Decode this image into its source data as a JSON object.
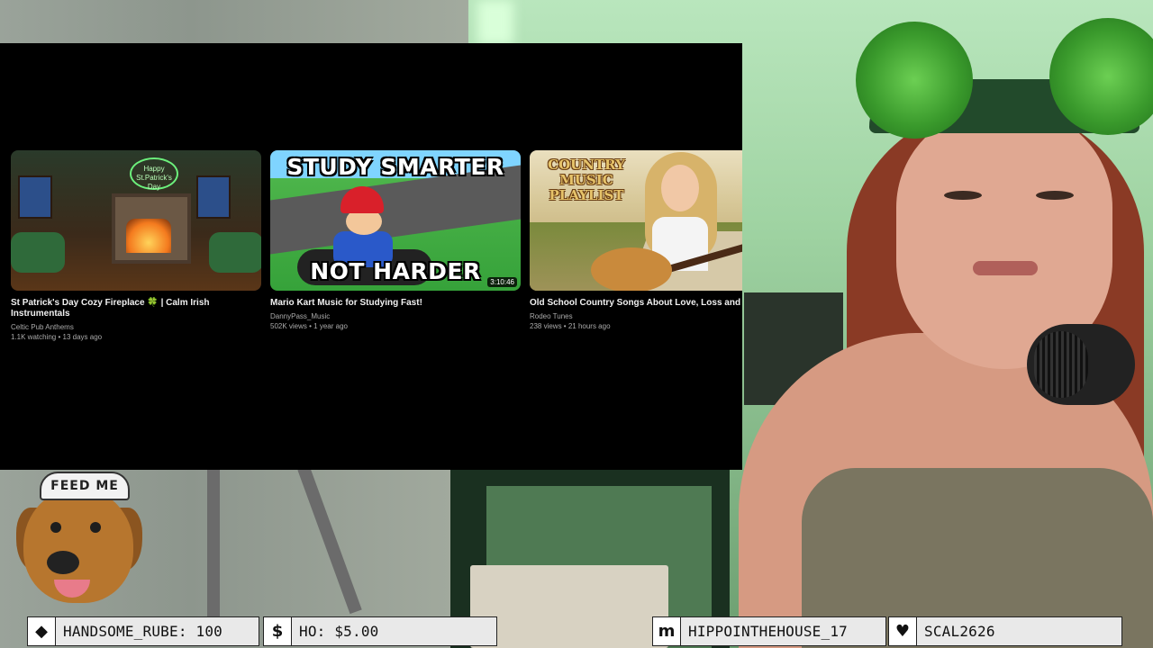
{
  "youtube": {
    "videos": [
      {
        "title": "St Patrick's Day Cozy Fireplace 🍀 | Calm Irish Instrumentals",
        "channel": "Celtic Pub Anthems",
        "meta": "1.1K watching • 13 days ago",
        "thumb_text": "Happy St.Patrick's Day"
      },
      {
        "title": "Mario Kart Music for Studying Fast!",
        "channel": "DannyPass_Music",
        "meta": "502K views • 1 year ago",
        "thumb_top": "STUDY SMARTER",
        "thumb_bottom": "NOT HARDER",
        "duration": "3:10:46"
      },
      {
        "title": "Old School Country Songs About Love, Loss and Re",
        "channel": "Rodeo Tunes",
        "meta": "238 views • 21 hours ago",
        "thumb_logo": "COUNTRY MUSIC PLAYLIST"
      }
    ]
  },
  "overlay": {
    "dog_hat_text": "FEED ME"
  },
  "ticker": {
    "items": [
      {
        "icon": "diamond-icon",
        "glyph": "◆",
        "label": "HANDSOME_RUBE: 100"
      },
      {
        "icon": "dollar-icon",
        "glyph": "$",
        "label": "HO: $5.00"
      },
      {
        "icon": "m-icon",
        "glyph": "m",
        "label": "HIPPOINTHEHOUSE_17"
      },
      {
        "icon": "heart-icon",
        "glyph": "♥",
        "label": "SCAL2626"
      }
    ]
  }
}
